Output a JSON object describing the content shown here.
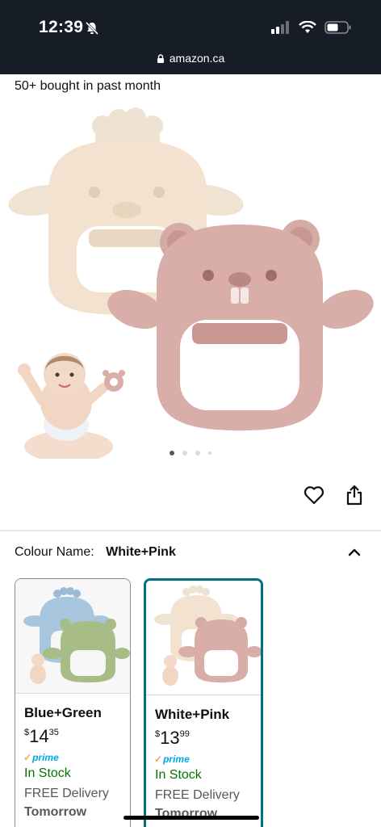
{
  "status_bar": {
    "time": "12:39"
  },
  "browser": {
    "url": "amazon.ca"
  },
  "product": {
    "social_proof": "50+ bought in past month",
    "carousel": {
      "total_dots": 4,
      "active_index": 0
    }
  },
  "variation": {
    "label": "Colour Name:",
    "selected_value": "White+Pink",
    "options": [
      {
        "name": "Blue+Green",
        "price_symbol": "$",
        "price_whole": "14",
        "price_fraction": "35",
        "prime": "prime",
        "stock": "In Stock",
        "delivery": "FREE Delivery",
        "delivery_day": "Tomorrow"
      },
      {
        "name": "White+Pink",
        "price_symbol": "$",
        "price_whole": "13",
        "price_fraction": "99",
        "prime": "prime",
        "stock": "In Stock",
        "delivery": "FREE Delivery",
        "delivery_day": "Tomorrow"
      }
    ]
  },
  "colors": {
    "header_bg": "#161d26",
    "selected_border": "#007185",
    "in_stock": "#007600",
    "prime_blue": "#00a8e1",
    "teether_cream": "#f3e2cf",
    "teether_pink": "#d9aea8",
    "teether_blue": "#a9c6df",
    "teether_green": "#a8bd85"
  },
  "icons": [
    "mute-icon",
    "cellular-signal-icon",
    "wifi-icon",
    "battery-icon",
    "lock-icon",
    "heart-icon",
    "share-icon",
    "chevron-up-icon"
  ]
}
